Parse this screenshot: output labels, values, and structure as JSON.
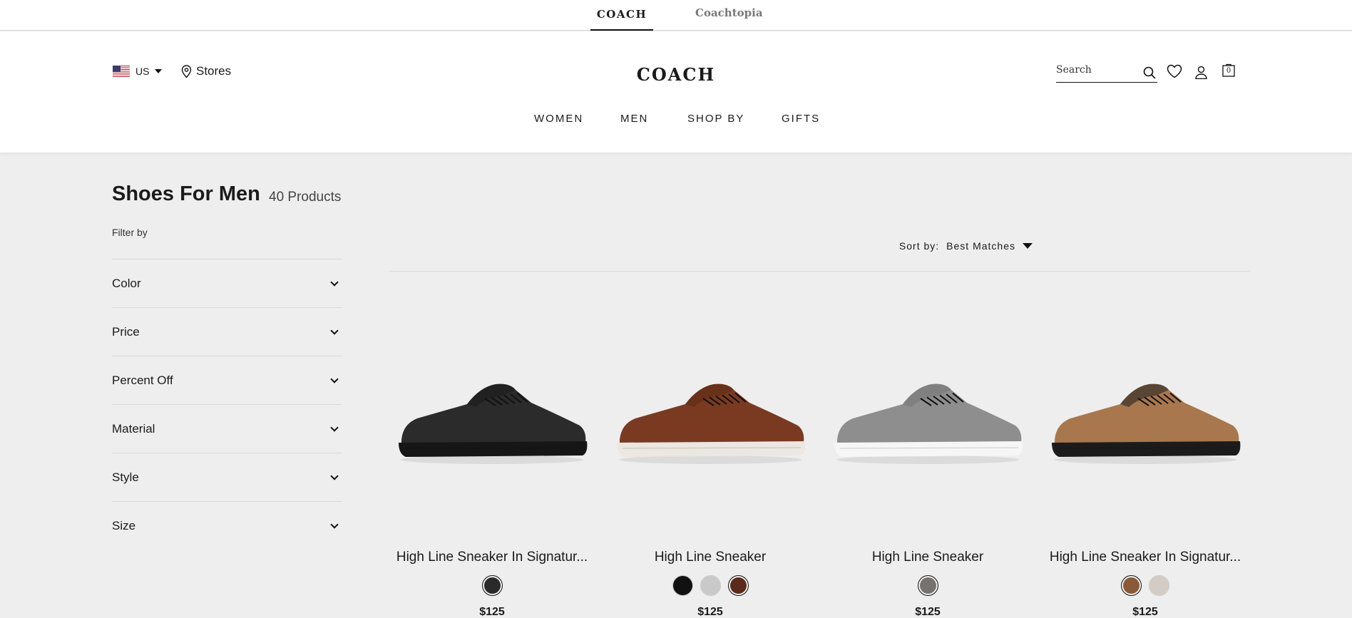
{
  "brand_tabs": [
    {
      "label": "COACH"
    },
    {
      "label": "Coachtopia"
    }
  ],
  "header": {
    "locale": "US",
    "stores": "Stores",
    "logo": "COACH",
    "search_placeholder": "Search",
    "bag_count": "0"
  },
  "nav": [
    "WOMEN",
    "MEN",
    "SHOP BY",
    "GIFTS"
  ],
  "page": {
    "title": "Shoes For Men",
    "count": "40 Products",
    "filter_label": "Filter by"
  },
  "filters": [
    "Color",
    "Price",
    "Percent Off",
    "Material",
    "Style",
    "Size"
  ],
  "sort": {
    "label": "Sort by:",
    "value": "Best Matches"
  },
  "products": [
    {
      "name": "High Line Sneaker In Signatur...",
      "price": "$125",
      "shoe": {
        "upper": "#2b2b2b",
        "accent": "#1a1a1a",
        "sole": "#161616"
      },
      "swatches": [
        {
          "color": "#2a2a2a",
          "selected": true
        }
      ]
    },
    {
      "name": "High Line Sneaker",
      "price": "$125",
      "shoe": {
        "upper": "#7a3a22",
        "accent": "#5e2a16",
        "sole": "#ece8e1"
      },
      "swatches": [
        {
          "color": "#111111",
          "selected": false
        },
        {
          "color": "#c9c9c9",
          "selected": false
        },
        {
          "color": "#5b2a1a",
          "selected": true
        }
      ]
    },
    {
      "name": "High Line Sneaker",
      "price": "$125",
      "shoe": {
        "upper": "#8e8e8e",
        "accent": "#777777",
        "sole": "#f6f6f6"
      },
      "swatches": [
        {
          "color": "#777272",
          "selected": true
        }
      ]
    },
    {
      "name": "High Line Sneaker In Signatur...",
      "price": "$125",
      "shoe": {
        "upper": "#a9774d",
        "accent": "#242424",
        "sole": "#1b1b1b"
      },
      "swatches": [
        {
          "color": "#8a5a38",
          "selected": true
        },
        {
          "color": "#d4ccc4",
          "selected": false
        }
      ]
    }
  ]
}
